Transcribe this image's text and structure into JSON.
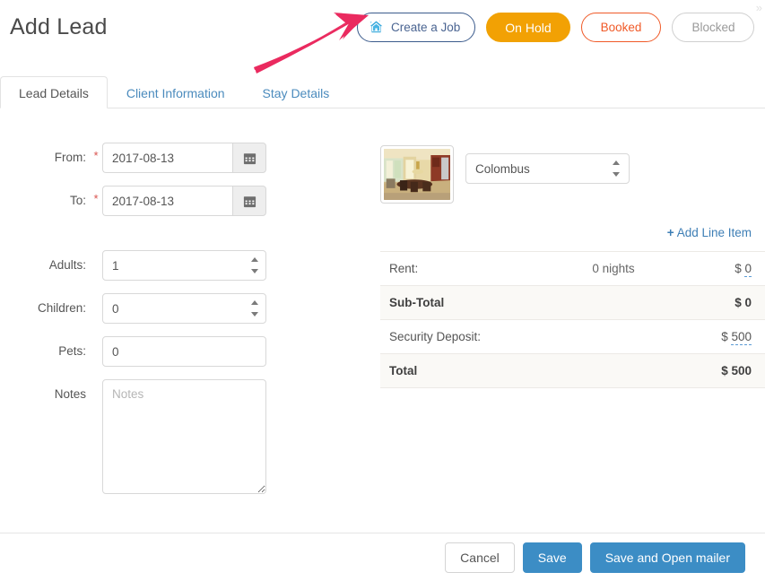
{
  "header": {
    "title": "Add Lead",
    "corner_glyph": "»",
    "actions": [
      {
        "label": "Create a Job",
        "icon": "house-sparkle-icon",
        "style": "outline-blue"
      },
      {
        "label": "On Hold",
        "icon": null,
        "style": "solid-amber"
      },
      {
        "label": "Booked",
        "icon": null,
        "style": "outline-orange"
      },
      {
        "label": "Blocked",
        "icon": null,
        "style": "outline-grey"
      }
    ]
  },
  "annotation": {
    "type": "arrow",
    "color": "#ea2a5f",
    "points_to": "Create a Job"
  },
  "tabs": [
    {
      "label": "Lead Details",
      "active": true
    },
    {
      "label": "Client Information",
      "active": false
    },
    {
      "label": "Stay Details",
      "active": false
    }
  ],
  "form": {
    "from": {
      "label": "From:",
      "required": "*",
      "value": "2017-08-13",
      "placeholder": "",
      "icon": "calendar-icon"
    },
    "to": {
      "label": "To:",
      "required": "*",
      "value": "2017-08-13",
      "placeholder": "",
      "icon": "calendar-icon"
    },
    "adults": {
      "label": "Adults:",
      "value": "1"
    },
    "children": {
      "label": "Children:",
      "value": "0"
    },
    "pets": {
      "label": "Pets:",
      "value": "0"
    },
    "notes": {
      "label": "Notes",
      "value": "",
      "placeholder": "Notes"
    }
  },
  "property": {
    "thumbnail_alt": "property-interior-photo",
    "selected": "Colombus"
  },
  "line_items": {
    "add_label": "Add Line Item",
    "add_plus": "+"
  },
  "pricing": {
    "rows": [
      {
        "label": "Rent:",
        "middle": "0 nights",
        "currency": "$",
        "amount": "0",
        "bold": false,
        "shaded": false,
        "editable": true
      },
      {
        "label": "Sub-Total",
        "middle": "",
        "currency": "$",
        "amount": "0",
        "bold": true,
        "shaded": true,
        "editable": false
      },
      {
        "label": "Security Deposit:",
        "middle": "",
        "currency": "$",
        "amount": "500",
        "bold": false,
        "shaded": false,
        "editable": true
      },
      {
        "label": "Total",
        "middle": "",
        "currency": "$",
        "amount": "500",
        "bold": true,
        "shaded": true,
        "editable": false
      }
    ]
  },
  "footer": {
    "cancel": "Cancel",
    "save": "Save",
    "save_open_mailer": "Save and Open mailer"
  },
  "colors": {
    "accent_blue": "#3c8dc5",
    "link_blue": "#3d7eb5",
    "amber": "#f2a104",
    "orange": "#f05a28",
    "annotation_pink": "#ea2a5f",
    "row_shade": "#faf9f6"
  }
}
